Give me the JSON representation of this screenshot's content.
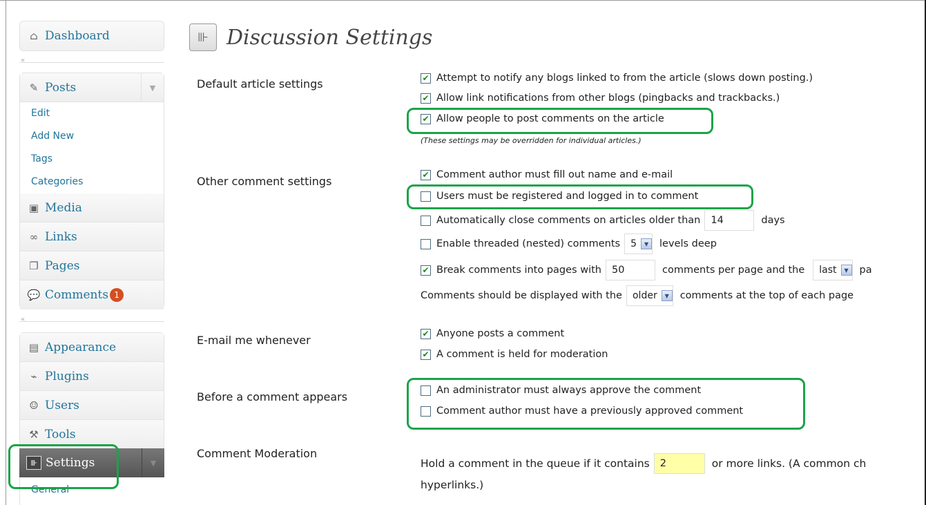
{
  "sidebar": {
    "dashboard": "Dashboard",
    "posts": "Posts",
    "posts_sub": [
      "Edit",
      "Add New",
      "Tags",
      "Categories"
    ],
    "media": "Media",
    "links": "Links",
    "pages": "Pages",
    "comments": "Comments",
    "comments_count": "1",
    "appearance": "Appearance",
    "plugins": "Plugins",
    "users": "Users",
    "tools": "Tools",
    "settings": "Settings",
    "settings_sub": [
      "General"
    ],
    "collapse_glyph": "«"
  },
  "page": {
    "title": "Discussion Settings",
    "icon": "settings-sliders-icon"
  },
  "sections": {
    "default_article": {
      "label": "Default article settings",
      "options": [
        {
          "text": "Attempt to notify any blogs linked to from the article (slows down posting.)",
          "checked": true
        },
        {
          "text": "Allow link notifications from other blogs (pingbacks and trackbacks.)",
          "checked": true
        },
        {
          "text": "Allow people to post comments on the article",
          "checked": true
        }
      ],
      "note": "(These settings may be overridden for individual articles.)"
    },
    "other_comment": {
      "label": "Other comment settings",
      "opt_author_fill": "Comment author must fill out name and e-mail",
      "opt_registered": "Users must be registered and logged in to comment",
      "opt_autoclose_pre": "Automatically close comments on articles older than",
      "autoclose_days": "14",
      "opt_autoclose_post": "days",
      "opt_threaded_pre": "Enable threaded (nested) comments",
      "threaded_levels": "5",
      "opt_threaded_post": "levels deep",
      "opt_break_pre": "Break comments into pages with",
      "per_page": "50",
      "opt_break_mid": "comments per page and the",
      "page_order": "last",
      "opt_break_post": "pa",
      "display_pre": "Comments should be displayed with the",
      "display_order": "older",
      "display_post": "comments at the top of each page",
      "checked": {
        "author_fill": true,
        "registered": false,
        "autoclose": false,
        "threaded": false,
        "break": true
      }
    },
    "email": {
      "label": "E-mail me whenever",
      "opt_anyone": "Anyone posts a comment",
      "opt_held": "A comment is held for moderation"
    },
    "before": {
      "label": "Before a comment appears",
      "opt_admin": "An administrator must always approve the comment",
      "opt_prev": "Comment author must have a previously approved comment"
    },
    "moderation": {
      "label": "Comment Moderation",
      "hold_pre": "Hold a comment in the queue if it contains",
      "links_count": "2",
      "hold_post": "or more links. (A common ch",
      "hold_line2": "hyperlinks.)"
    }
  },
  "colors": {
    "highlight": "#1aa34a",
    "link": "#21759b",
    "badge": "#d54e21"
  }
}
